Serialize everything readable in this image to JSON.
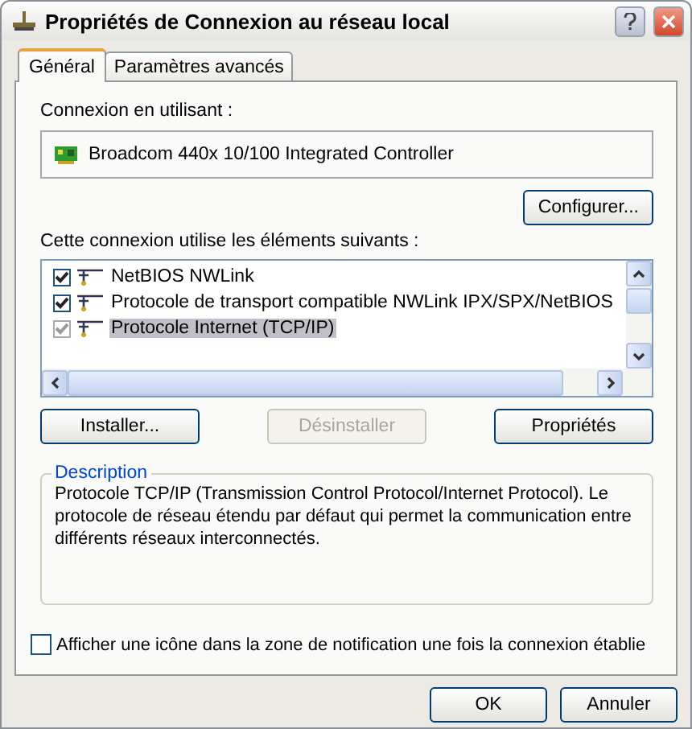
{
  "window": {
    "title": "Propriétés de Connexion au réseau local"
  },
  "tabs": [
    {
      "label": "Général",
      "selected": true
    },
    {
      "label": "Paramètres avancés",
      "selected": false
    }
  ],
  "connection": {
    "label": "Connexion en utilisant :",
    "adapter": "Broadcom 440x 10/100 Integrated Controller",
    "configure_button": "Configurer..."
  },
  "components": {
    "label": "Cette connexion utilise les éléments suivants :",
    "items": [
      {
        "label": "NetBIOS NWLink",
        "checked": true,
        "disabled": false,
        "selected": false
      },
      {
        "label": "Protocole de transport compatible NWLink IPX/SPX/NetBIOS",
        "checked": true,
        "disabled": false,
        "selected": false
      },
      {
        "label": "Protocole Internet (TCP/IP)",
        "checked": true,
        "disabled": true,
        "selected": true
      }
    ]
  },
  "actions": [
    {
      "label": "Installer...",
      "disabled": false
    },
    {
      "label": "Désinstaller",
      "disabled": true
    },
    {
      "label": "Propriétés",
      "disabled": false
    }
  ],
  "description": {
    "title": "Description",
    "text": "Protocole TCP/IP (Transmission Control Protocol/Internet Protocol). Le protocole de réseau étendu par défaut qui permet la communication entre différents réseaux interconnectés."
  },
  "notify_option": {
    "label": "Afficher une icône dans la zone de notification une fois la connexion établie",
    "checked": false
  },
  "buttons": [
    "OK",
    "Annuler"
  ]
}
